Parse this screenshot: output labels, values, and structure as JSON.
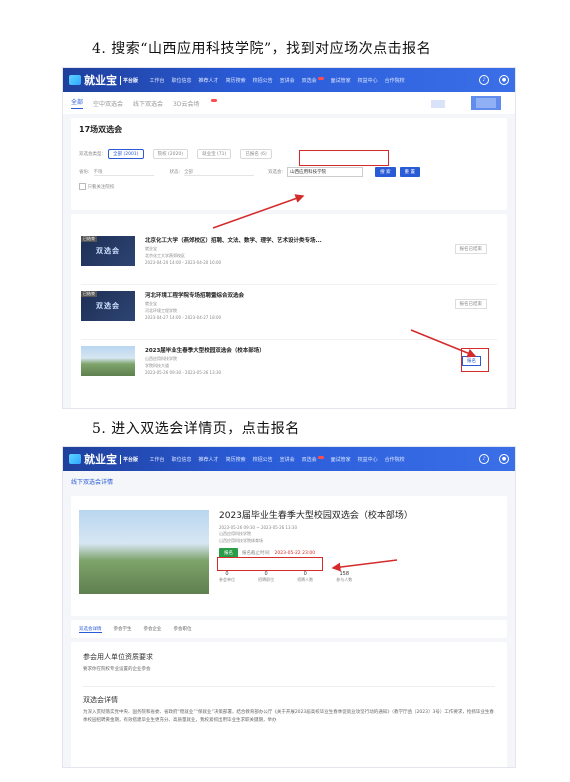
{
  "steps": {
    "step4": "4. 搜索“山西应用科技学院”，找到对应场次点击报名",
    "step5": "5. 进入双选会详情页，点击报名"
  },
  "nav": {
    "logo": "就业宝",
    "logo_sub": "平台版",
    "items": [
      "工作台",
      "职位信息",
      "推荐人才",
      "简历搜索",
      "校招公告",
      "宣讲会",
      "双选会",
      "面试管家",
      "权益中心",
      "合作院校"
    ],
    "accent": "#2a5bd7"
  },
  "shot1": {
    "tabs": [
      "全部",
      "空中双选会",
      "线下双选会",
      "3D云会场"
    ],
    "count_title": "17场双选会",
    "type_label": "双选会类型:",
    "type_chips": [
      "全部 (2001)",
      "院校 (2020)",
      "就业宝 (71)",
      "已报名 (6)"
    ],
    "province_label": "省份:",
    "province_value": "不限",
    "status_label": "状态:",
    "status_value": "全部",
    "school_label": "双选会:",
    "search_value": "山西应用科技学院",
    "search_btn": "搜 索",
    "reset_btn": "重 置",
    "only_follow": "只看关注院校",
    "cards": [
      {
        "tag": "已结束",
        "thumb_text": "双选会",
        "title": "北京化工大学（燕郊校区）招聘、文法、数学、理学、艺术设计类专场...",
        "org": "就业宝",
        "place": "北京化工大学燕郊校区",
        "time": "2023-04-20 14:00 - 2023-04-20 16:00",
        "btn": "报名已结束"
      },
      {
        "tag": "已结束",
        "thumb_text": "双选会",
        "title": "河北环境工程学院专场招聘暨综合双选会",
        "org": "就业宝",
        "place": "河北环境工程学院",
        "time": "2023-04-27 14:00 - 2023-04-27 18:00",
        "btn": "报名已结束"
      },
      {
        "tag": "",
        "thumb_text": "",
        "title": "2023届毕业生春季大型校园双选会（校本部场）",
        "org": "山西应用科技学院",
        "place": "学院科技大道",
        "time": "2023-05-26 09:30 - 2023-05-26 13:30",
        "btn": "报名"
      }
    ]
  },
  "shot2": {
    "breadcrumb": "线下双选会详情",
    "title": "2023届毕业生春季大型校园双选会（校本部场）",
    "time": "2023-05-26 09:30 ~ 2023-05-26 13:30",
    "org": "山西应用科技学院",
    "place": "山西应用科技学院体育场",
    "apply_btn": "报名",
    "deadline_label": "报名截止时间:",
    "deadline": "2023-05-22 23:00",
    "stats": [
      {
        "n": "0",
        "t": "参会单位"
      },
      {
        "n": "0",
        "t": "招聘职位"
      },
      {
        "n": "0",
        "t": "招聘人数"
      },
      {
        "n": "158",
        "t": "参与人数"
      }
    ],
    "subtabs": [
      "双选会详情",
      "参会学生",
      "参会企业",
      "参会职位"
    ],
    "req_title": "参会用人单位资质要求",
    "req_text": "要求你在院校专业设置的企业参会",
    "detail_title": "双选会详情",
    "detail_text": "为深入贯彻落实党中央、国务院和省委、省政府“稳就业”“保就业”决策部署，结合教育部办公厅《关于开展2023届高校毕业生春季促就业攻坚行动的通知》（教学厅函〔2023〕3号）工作要求，抢抓毕业生春季校园招聘黄金期，有效搭建毕业生更充分、高质量就业，我校紧抓出用毕业生求职关键期，举办"
  }
}
